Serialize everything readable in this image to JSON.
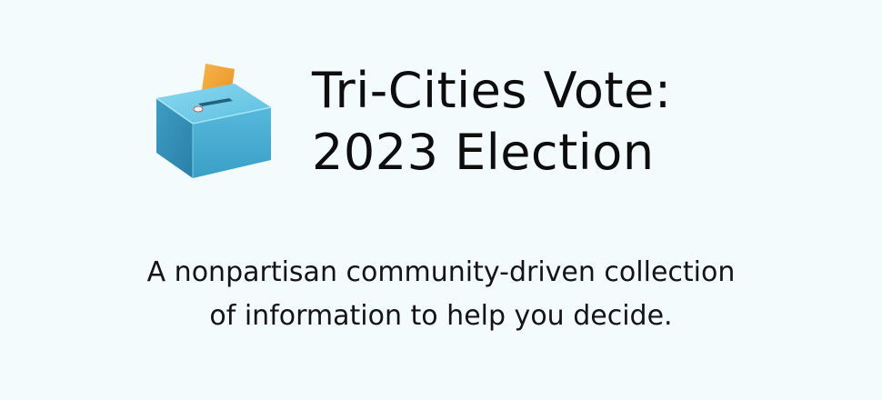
{
  "header": {
    "logo_icon": "ballot-box-icon",
    "title_line1": "Tri-Cities Vote:",
    "title_line2": "2023 Election"
  },
  "tagline": {
    "line1": "A nonpartisan community-driven collection",
    "line2": "of information to help you decide."
  },
  "colors": {
    "background": "#f3fbfc",
    "box": "#4fb6d6",
    "ballot": "#f4a63a",
    "text": "#111111"
  }
}
